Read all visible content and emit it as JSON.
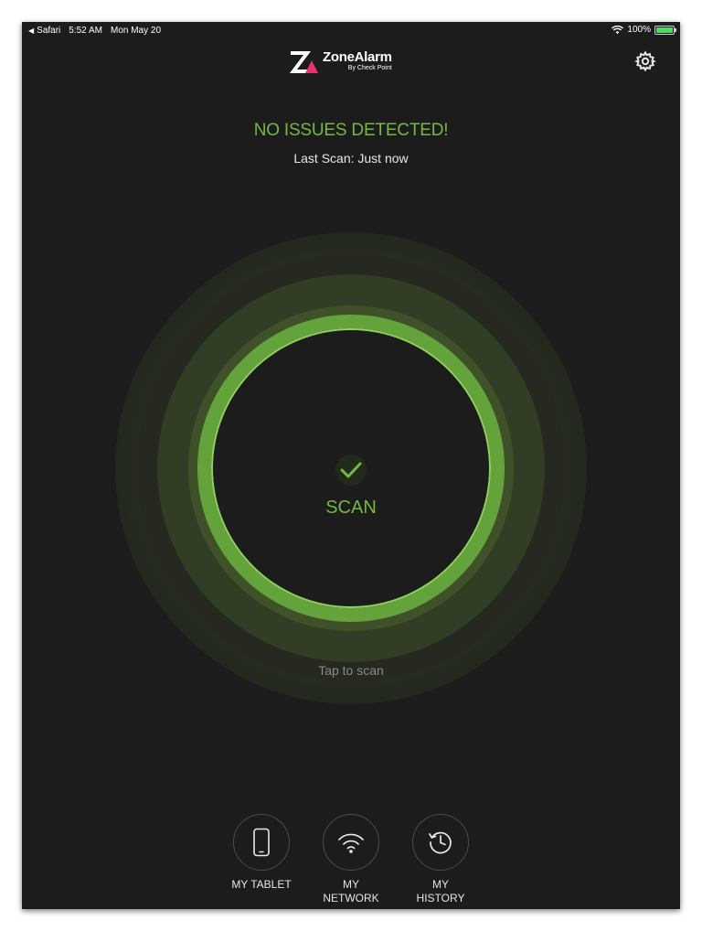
{
  "status_bar": {
    "back_app": "Safari",
    "time": "5:52 AM",
    "date": "Mon May 20",
    "battery_percent": "100%",
    "battery_level": 1.0
  },
  "header": {
    "logo_name": "ZoneAlarm",
    "logo_sub": "By Check Point"
  },
  "status": {
    "title": "NO ISSUES DETECTED!",
    "last_scan": "Last Scan: Just now"
  },
  "scan": {
    "label": "SCAN",
    "hint": "Tap to scan"
  },
  "nav": {
    "items": [
      {
        "label": "MY TABLET",
        "icon": "tablet-icon"
      },
      {
        "label": "MY\nNETWORK",
        "icon": "wifi-icon"
      },
      {
        "label": "MY\nHISTORY",
        "icon": "history-icon"
      }
    ]
  },
  "colors": {
    "background": "#1c1c1c",
    "accent_green": "#74b843",
    "ring_bright": "#8fd35a",
    "logo_accent": "#e8336d"
  }
}
